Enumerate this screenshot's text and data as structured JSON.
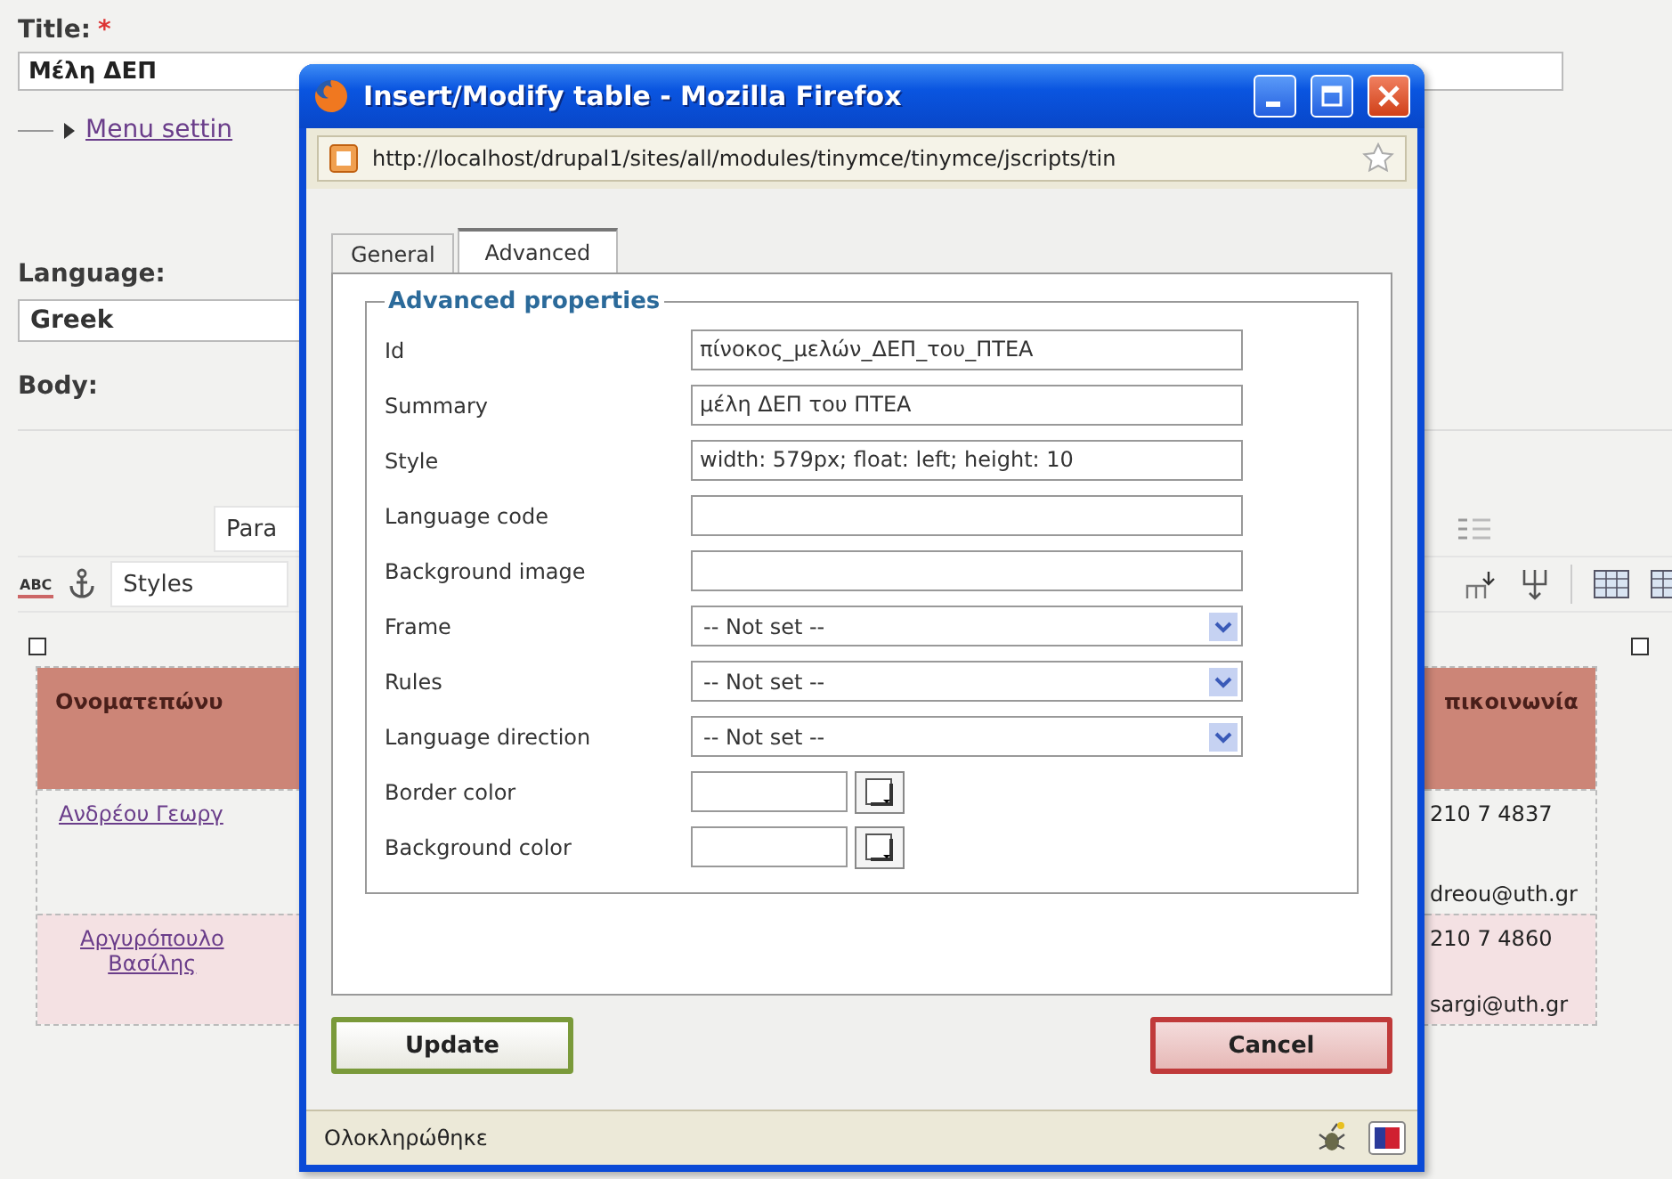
{
  "page": {
    "title_label": "Title:",
    "required_mark": "*",
    "title_value": "Μέλη ΔΕΠ",
    "menu_link": "Menu settin",
    "language_label": "Language:",
    "language_value": "Greek",
    "body_label": "Body:"
  },
  "editor": {
    "format_select": "Para",
    "spellcheck_label": "ABC",
    "styles_select": "Styles",
    "table": {
      "headers": [
        "Ονοματεπώνυ",
        "πικοινωνία"
      ],
      "rows": [
        {
          "name_lines": [
            "Ανδρέου Γεωργ"
          ],
          "phone": "210 7 4837",
          "email": "dreou@uth.gr"
        },
        {
          "name_lines": [
            "Αργυρόπουλο",
            "Βασίλης"
          ],
          "phone": "210 7 4860",
          "email": "sargi@uth.gr"
        }
      ]
    }
  },
  "dialog": {
    "title": "Insert/Modify table - Mozilla Firefox",
    "url": "http://localhost/drupal1/sites/all/modules/tinymce/tinymce/jscripts/tin",
    "tabs": [
      {
        "label": "General",
        "selected": false
      },
      {
        "label": "Advanced",
        "selected": true
      }
    ],
    "legend": "Advanced properties",
    "fields": [
      {
        "kind": "text",
        "label": "Id",
        "value": "πίνοκος_μελών_ΔΕΠ_του_ΠΤΕΑ"
      },
      {
        "kind": "text",
        "label": "Summary",
        "value": "μέλη  ΔΕΠ του ΠΤΕΑ"
      },
      {
        "kind": "text",
        "label": "Style",
        "value": "width: 579px; float: left; height: 10"
      },
      {
        "kind": "text",
        "label": "Language code"
      },
      {
        "kind": "text",
        "label": "Background image"
      },
      {
        "kind": "select",
        "label": "Frame",
        "value": "-- Not set --"
      },
      {
        "kind": "select",
        "label": "Rules",
        "value": "-- Not set --"
      },
      {
        "kind": "select",
        "label": "Language direction",
        "value": "-- Not set --"
      },
      {
        "kind": "color",
        "label": "Border color"
      },
      {
        "kind": "color",
        "label": "Background color"
      }
    ],
    "buttons": [
      {
        "kind": "update",
        "label": "Update"
      },
      {
        "kind": "cancel",
        "label": "Cancel"
      }
    ],
    "status": "Ολοκληρώθηκε"
  }
}
